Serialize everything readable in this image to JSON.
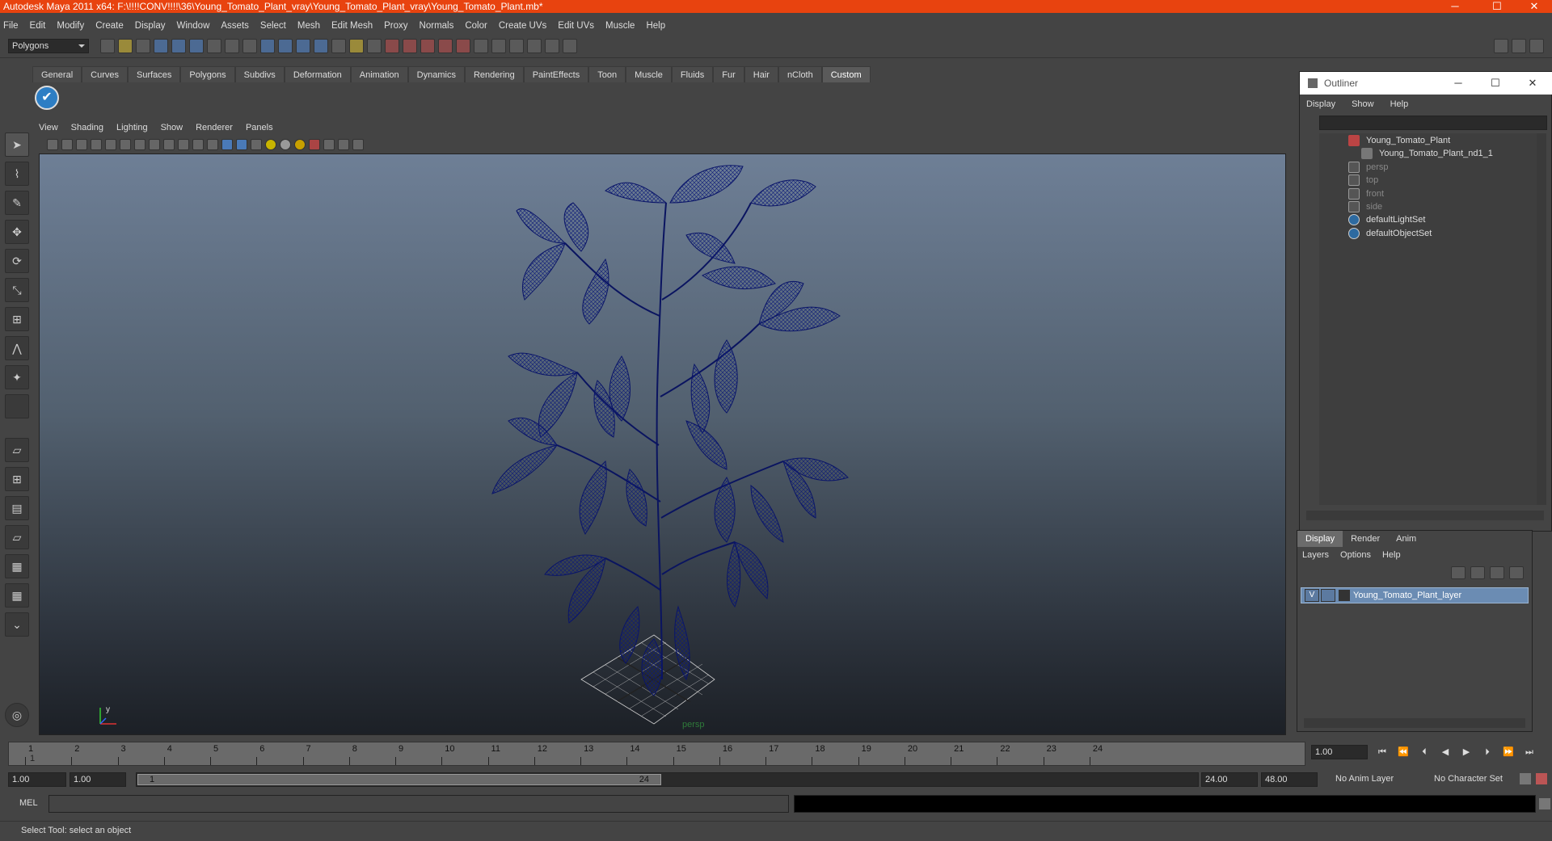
{
  "window": {
    "title": "Autodesk Maya 2011 x64: F:\\!!!!CONV!!!!\\36\\Young_Tomato_Plant_vray\\Young_Tomato_Plant_vray\\Young_Tomato_Plant.mb*"
  },
  "menubar": [
    "File",
    "Edit",
    "Modify",
    "Create",
    "Display",
    "Window",
    "Assets",
    "Select",
    "Mesh",
    "Edit Mesh",
    "Proxy",
    "Normals",
    "Color",
    "Create UVs",
    "Edit UVs",
    "Muscle",
    "Help"
  ],
  "modeSelector": {
    "value": "Polygons"
  },
  "shelfTabs": [
    "General",
    "Curves",
    "Surfaces",
    "Polygons",
    "Subdivs",
    "Deformation",
    "Animation",
    "Dynamics",
    "Rendering",
    "PaintEffects",
    "Toon",
    "Muscle",
    "Fluids",
    "Fur",
    "Hair",
    "nCloth",
    "Custom"
  ],
  "activeShelfTab": "Custom",
  "panelMenu": [
    "View",
    "Shading",
    "Lighting",
    "Show",
    "Renderer",
    "Panels"
  ],
  "viewport": {
    "cameraLabel": "persp",
    "axisX": "x",
    "axisY": "y"
  },
  "outliner": {
    "title": "Outliner",
    "menu": [
      "Display",
      "Show",
      "Help"
    ],
    "items": [
      {
        "label": "Young_Tomato_Plant",
        "icon": "transform-icon",
        "dim": false
      },
      {
        "label": "Young_Tomato_Plant_nd1_1",
        "icon": "mesh-icon",
        "dim": false
      },
      {
        "label": "persp",
        "icon": "camera-icon",
        "dim": true
      },
      {
        "label": "top",
        "icon": "camera-icon",
        "dim": true
      },
      {
        "label": "front",
        "icon": "camera-icon",
        "dim": true
      },
      {
        "label": "side",
        "icon": "camera-icon",
        "dim": true
      },
      {
        "label": "defaultLightSet",
        "icon": "set-icon",
        "dim": false
      },
      {
        "label": "defaultObjectSet",
        "icon": "set-icon",
        "dim": false
      }
    ]
  },
  "layerEditor": {
    "tabs": [
      "Display",
      "Render",
      "Anim"
    ],
    "menu": [
      "Layers",
      "Options",
      "Help"
    ],
    "layer": {
      "visible": "V",
      "name": "Young_Tomato_Plant_layer"
    }
  },
  "timeSlider": {
    "ticks": [
      "1",
      "2",
      "3",
      "4",
      "5",
      "6",
      "7",
      "8",
      "9",
      "10",
      "11",
      "12",
      "13",
      "14",
      "15",
      "16",
      "17",
      "18",
      "19",
      "20",
      "21",
      "22",
      "23",
      "24"
    ],
    "startMarker": "1",
    "currentFrame": "1.00"
  },
  "rangeSlider": {
    "startTime": "1.00",
    "playbackStart": "1.00",
    "rangeStartLabel": "1",
    "rangeEndLabel": "24",
    "playbackEnd": "24.00",
    "endTime": "48.00",
    "animLayer": "No Anim Layer",
    "characterSet": "No Character Set"
  },
  "commandLine": {
    "label": "MEL"
  },
  "helpLine": {
    "text": "Select Tool: select an object"
  }
}
